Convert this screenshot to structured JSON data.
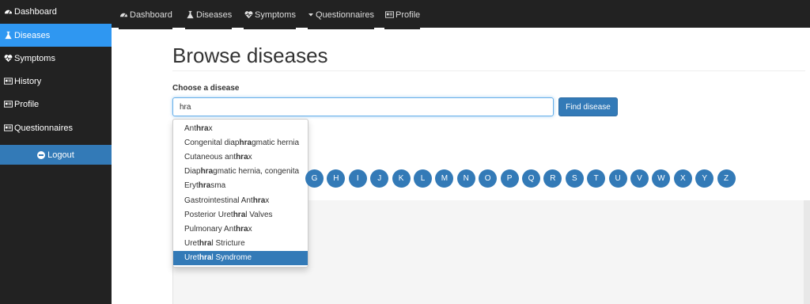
{
  "sidebar": {
    "items": [
      {
        "label": "Dashboard",
        "icon": "dashboard-icon"
      },
      {
        "label": "Diseases",
        "icon": "flask-icon",
        "active": true
      },
      {
        "label": "Symptoms",
        "icon": "heartbeat-icon"
      },
      {
        "label": "History",
        "icon": "id-card-icon"
      },
      {
        "label": "Profile",
        "icon": "id-card-icon"
      },
      {
        "label": "Questionnaires",
        "icon": "id-card-icon"
      }
    ],
    "logout_label": "Logout"
  },
  "topnav": {
    "items": [
      {
        "label": "Dashboard",
        "icon": "dashboard-icon"
      },
      {
        "label": "Diseases",
        "icon": "flask-icon"
      },
      {
        "label": "Symptoms",
        "icon": "heartbeat-icon"
      },
      {
        "label": "Questionnaires",
        "icon": "caret-down-icon"
      },
      {
        "label": "Profile",
        "icon": "id-card-icon"
      }
    ]
  },
  "main": {
    "title": "Browse diseases",
    "choose_label": "Choose a disease",
    "search_value": "hra",
    "find_button_label": "Find disease"
  },
  "letters": [
    "G",
    "H",
    "I",
    "J",
    "K",
    "L",
    "M",
    "N",
    "O",
    "P",
    "Q",
    "R",
    "S",
    "T",
    "U",
    "V",
    "W",
    "X",
    "Y",
    "Z"
  ],
  "suggestions": {
    "query": "hra",
    "items": [
      {
        "text": "Anthrax"
      },
      {
        "text": "Congenital diaphragmatic hernia"
      },
      {
        "text": "Cutaneous anthrax"
      },
      {
        "text": "Diaphragmatic hernia, congenita"
      },
      {
        "text": "Erythrasma"
      },
      {
        "text": "Gastrointestinal Anthrax"
      },
      {
        "text": "Posterior Urethral Valves"
      },
      {
        "text": "Pulmonary Anthrax"
      },
      {
        "text": "Urethral Stricture"
      },
      {
        "text": "Urethral Syndrome",
        "active": true
      }
    ]
  },
  "colors": {
    "sidebar_bg": "#222222",
    "active_blue": "#2f97f1",
    "primary": "#337ab7"
  }
}
